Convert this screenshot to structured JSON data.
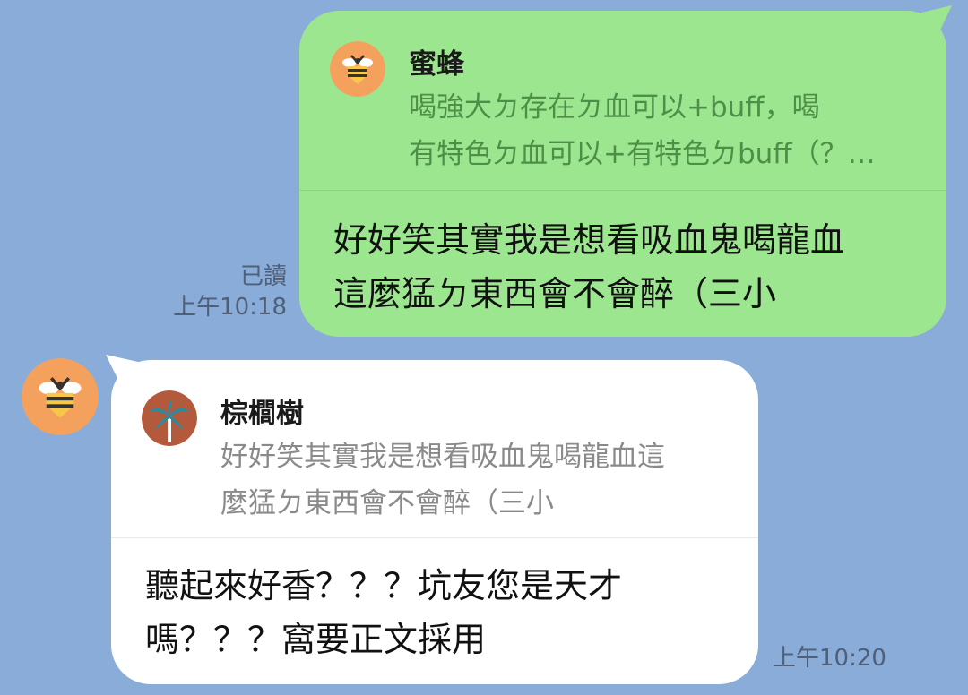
{
  "colors": {
    "background": "#8aacd8",
    "outgoing_bubble": "#9de690",
    "incoming_bubble": "#ffffff",
    "bee_avatar": "#f5a15e",
    "palm_avatar": "#b45a3c",
    "palm_leaf": "#2a8aa0"
  },
  "outgoing_message": {
    "quote": {
      "avatar_icon": "bee-icon",
      "name": "蜜蜂",
      "line1": "喝強大ㄉ存在ㄉ血可以+buff，喝",
      "line2": "有特色ㄉ血可以+有特色ㄉbuff（？…"
    },
    "line1": "好好笑其實我是想看吸血鬼喝龍血",
    "line2": "這麼猛ㄉ東西會不會醉（三小",
    "read_label": "已讀",
    "time": "上午10:18"
  },
  "incoming_message": {
    "sender_avatar_icon": "bee-icon",
    "quote": {
      "avatar_icon": "palm-tree-icon",
      "name": "棕櫚樹",
      "line1": "好好笑其實我是想看吸血鬼喝龍血這",
      "line2": "麼猛ㄉ東西會不會醉（三小"
    },
    "line1": "聽起來好香？？？坑友您是天才",
    "line2": "嗎？？？窩要正文採用",
    "time": "上午10:20"
  }
}
